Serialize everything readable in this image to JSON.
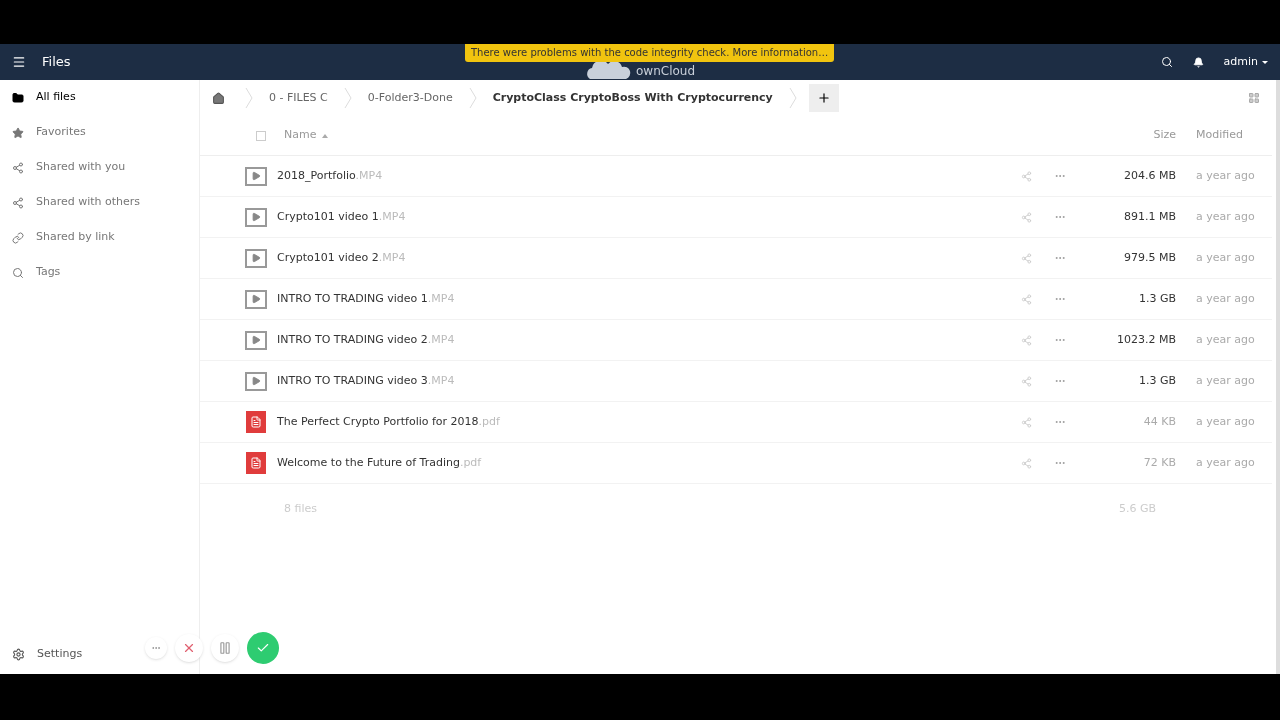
{
  "header": {
    "app_title": "Files",
    "logo_text": "ownCloud",
    "notice": "There were problems with the code integrity check. More information…",
    "user": "admin"
  },
  "sidebar": {
    "items": [
      {
        "label": "All files",
        "selected": true
      },
      {
        "label": "Favorites",
        "selected": false
      },
      {
        "label": "Shared with you",
        "selected": false
      },
      {
        "label": "Shared with others",
        "selected": false
      },
      {
        "label": "Shared by link",
        "selected": false
      },
      {
        "label": "Tags",
        "selected": false
      }
    ],
    "settings": "Settings"
  },
  "breadcrumbs": [
    "0 - FILES C",
    "0-Folder3-Done",
    "CryptoClass CryptoBoss With Cryptocurrency"
  ],
  "table": {
    "select_all_checked": false,
    "columns": [
      "Name",
      "Size",
      "Modified"
    ],
    "rows": [
      {
        "name": "2018_Portfolio",
        "ext": ".MP4",
        "kind": "video",
        "size": "204.6 MB",
        "modified": "a year ago"
      },
      {
        "name": "Crypto101 video 1",
        "ext": ".MP4",
        "kind": "video",
        "size": "891.1 MB",
        "modified": "a year ago"
      },
      {
        "name": "Crypto101 video 2",
        "ext": ".MP4",
        "kind": "video",
        "size": "979.5 MB",
        "modified": "a year ago"
      },
      {
        "name": "INTRO TO TRADING video 1",
        "ext": ".MP4",
        "kind": "video",
        "size": "1.3 GB",
        "modified": "a year ago"
      },
      {
        "name": "INTRO TO TRADING video 2",
        "ext": ".MP4",
        "kind": "video",
        "size": "1023.2 MB",
        "modified": "a year ago"
      },
      {
        "name": "INTRO TO TRADING video 3",
        "ext": ".MP4",
        "kind": "video",
        "size": "1.3 GB",
        "modified": "a year ago"
      },
      {
        "name": "The Perfect Crypto Portfolio for 2018",
        "ext": ".pdf",
        "kind": "pdf",
        "size": "44 KB",
        "modified": "a year ago"
      },
      {
        "name": "Welcome to the Future of Trading",
        "ext": ".pdf",
        "kind": "pdf",
        "size": "72 KB",
        "modified": "a year ago"
      }
    ],
    "summary": {
      "count": "8 files",
      "total": "5.6 GB"
    }
  }
}
